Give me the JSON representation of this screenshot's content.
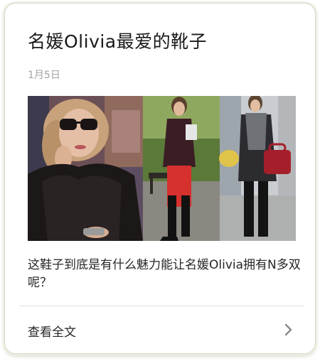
{
  "article": {
    "title": "名媛Olivia最爱的靴子",
    "date": "1月5日",
    "image": {
      "icon": "fashion-photo-collage"
    },
    "summary": "这鞋子到底是有什么魅力能让名媛Olivia拥有N多双呢？"
  },
  "footer": {
    "read_more_label": "查看全文",
    "chevron_icon": "chevron-right-icon"
  },
  "colors": {
    "title": "#1a1a1a",
    "date": "#a3a3a3",
    "body_text": "#262626",
    "divider": "#dcdcdc",
    "chevron": "#8c8c8c",
    "card_border": "#d9d9cf"
  }
}
